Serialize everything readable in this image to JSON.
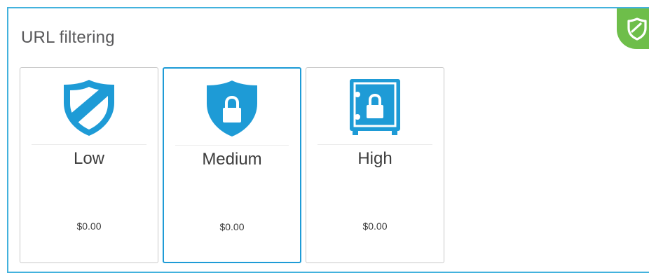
{
  "panel": {
    "title": "URL filtering",
    "badge_icon": "shield-check-icon",
    "accent_color": "#43b2dd",
    "badge_color": "#6ebe4a"
  },
  "cards": [
    {
      "name": "Low",
      "price": "$0.00",
      "icon": "shield-slash-icon",
      "selected": false
    },
    {
      "name": "Medium",
      "price": "$0.00",
      "icon": "shield-lock-icon",
      "selected": true
    },
    {
      "name": "High",
      "price": "$0.00",
      "icon": "vault-icon",
      "selected": false
    }
  ],
  "colors": {
    "icon_blue": "#1e9bd6",
    "selected_border": "#1e9bd6"
  }
}
